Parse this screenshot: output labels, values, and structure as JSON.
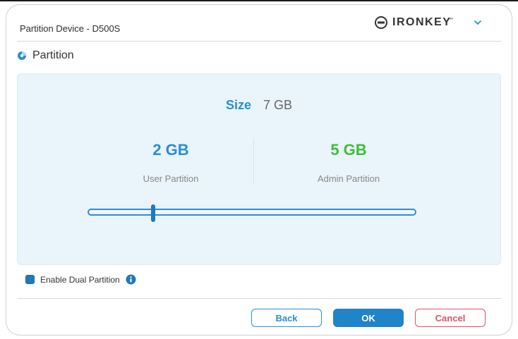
{
  "window": {
    "title": "Partition Device - D500S"
  },
  "brand": {
    "name": "IRONKEY",
    "trademark": "™",
    "icon": "ironkey-logo-icon",
    "menu_icon": "chevron-down-icon",
    "accent": "#2a8fd0"
  },
  "section": {
    "title": "Partition",
    "icon": "partition-icon"
  },
  "partition": {
    "size_label": "Size",
    "size_value": "7 GB",
    "user_value": "2 GB",
    "user_label": "User Partition",
    "admin_value": "5 GB",
    "admin_label": "Admin Partition",
    "user_color": "#2a8fd0",
    "admin_color": "#3fbe3a",
    "slider_fraction": 0.2
  },
  "options": {
    "dual_partition_label": "Enable Dual Partition",
    "dual_partition_checked": true,
    "info_icon": "info-icon"
  },
  "buttons": {
    "back": "Back",
    "ok": "OK",
    "cancel": "Cancel"
  }
}
